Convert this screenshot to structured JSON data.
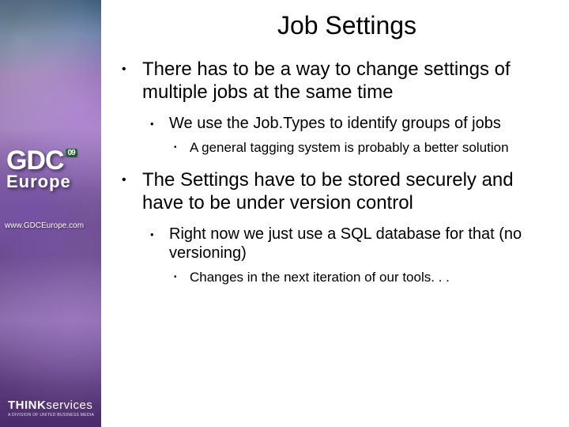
{
  "sidebar": {
    "logo_main": "GDC",
    "logo_badge": "09",
    "logo_sub": "Europe",
    "url": "www.GDCEurope.com",
    "footer_brand_a": "THINK",
    "footer_brand_b": "services",
    "footer_tag": "A DIVISION OF UNITED BUSINESS MEDIA"
  },
  "title": "Job Settings",
  "bullets": [
    {
      "text": "There has to be a way to change settings of multiple jobs at the same time",
      "children": [
        {
          "text": "We use the Job.Types to identify groups of jobs",
          "children": [
            {
              "text": "A general tagging system is probably a better solution"
            }
          ]
        }
      ]
    },
    {
      "text": "The Settings have to be stored securely and have to be under version control",
      "children": [
        {
          "text": "Right now we just use a SQL database for that (no versioning)",
          "children": [
            {
              "text": "Changes in the next iteration of our tools. . ."
            }
          ]
        }
      ]
    }
  ]
}
